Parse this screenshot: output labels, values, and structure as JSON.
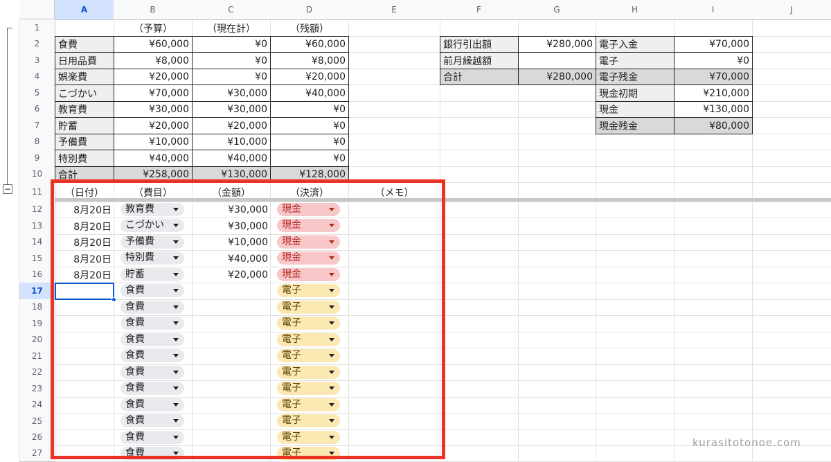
{
  "columns": [
    "A",
    "B",
    "C",
    "D",
    "E",
    "F",
    "G",
    "H",
    "I",
    "J"
  ],
  "rows": [
    "1",
    "2",
    "3",
    "4",
    "5",
    "6",
    "7",
    "8",
    "9",
    "10",
    "11",
    "12",
    "13",
    "14",
    "15",
    "16",
    "17",
    "18",
    "19",
    "20",
    "21",
    "22",
    "23",
    "24",
    "25",
    "26",
    "27"
  ],
  "group_toggle": "−",
  "header_row": {
    "b": "（予算）",
    "c": "（現在計）",
    "d": "（残額）"
  },
  "budget": [
    {
      "cat": "食費",
      "budget": "¥60,000",
      "current": "¥0",
      "remain": "¥60,000"
    },
    {
      "cat": "日用品費",
      "budget": "¥8,000",
      "current": "¥0",
      "remain": "¥8,000"
    },
    {
      "cat": "娯楽費",
      "budget": "¥20,000",
      "current": "¥0",
      "remain": "¥20,000"
    },
    {
      "cat": "こづかい",
      "budget": "¥70,000",
      "current": "¥30,000",
      "remain": "¥40,000"
    },
    {
      "cat": "教育費",
      "budget": "¥30,000",
      "current": "¥30,000",
      "remain": "¥0"
    },
    {
      "cat": "貯蓄",
      "budget": "¥20,000",
      "current": "¥20,000",
      "remain": "¥0"
    },
    {
      "cat": "予備費",
      "budget": "¥10,000",
      "current": "¥10,000",
      "remain": "¥0"
    },
    {
      "cat": "特別費",
      "budget": "¥40,000",
      "current": "¥40,000",
      "remain": "¥0"
    },
    {
      "cat": "合計",
      "budget": "¥258,000",
      "current": "¥130,000",
      "remain": "¥128,000"
    }
  ],
  "bank": [
    {
      "label": "銀行引出額",
      "value": "¥280,000"
    },
    {
      "label": "前月繰越額",
      "value": ""
    },
    {
      "label": "合計",
      "value": "¥280,000"
    }
  ],
  "wallet": [
    {
      "label": "電子入金",
      "value": "¥70,000"
    },
    {
      "label": "電子",
      "value": "¥0"
    },
    {
      "label": "電子残金",
      "value": "¥70,000"
    },
    {
      "label": "現金初期",
      "value": "¥210,000"
    },
    {
      "label": "現金",
      "value": "¥130,000"
    },
    {
      "label": "現金残金",
      "value": "¥80,000"
    }
  ],
  "entry_header": {
    "date": "（日付）",
    "cat": "（費目）",
    "amount": "（金額）",
    "pay": "（決済）",
    "memo": "（メモ）"
  },
  "entries": [
    {
      "date": "8月20日",
      "cat": "教育費",
      "amount": "¥30,000",
      "pay": "現金"
    },
    {
      "date": "8月20日",
      "cat": "こづかい",
      "amount": "¥30,000",
      "pay": "現金"
    },
    {
      "date": "8月20日",
      "cat": "予備費",
      "amount": "¥10,000",
      "pay": "現金"
    },
    {
      "date": "8月20日",
      "cat": "特別費",
      "amount": "¥40,000",
      "pay": "現金"
    },
    {
      "date": "8月20日",
      "cat": "貯蓄",
      "amount": "¥20,000",
      "pay": "現金"
    },
    {
      "date": "",
      "cat": "食費",
      "amount": "",
      "pay": "電子"
    },
    {
      "date": "",
      "cat": "食費",
      "amount": "",
      "pay": "電子"
    },
    {
      "date": "",
      "cat": "食費",
      "amount": "",
      "pay": "電子"
    },
    {
      "date": "",
      "cat": "食費",
      "amount": "",
      "pay": "電子"
    },
    {
      "date": "",
      "cat": "食費",
      "amount": "",
      "pay": "電子"
    },
    {
      "date": "",
      "cat": "食費",
      "amount": "",
      "pay": "電子"
    },
    {
      "date": "",
      "cat": "食費",
      "amount": "",
      "pay": "電子"
    },
    {
      "date": "",
      "cat": "食費",
      "amount": "",
      "pay": "電子"
    },
    {
      "date": "",
      "cat": "食費",
      "amount": "",
      "pay": "電子"
    },
    {
      "date": "",
      "cat": "食費",
      "amount": "",
      "pay": "電子"
    },
    {
      "date": "",
      "cat": "食費",
      "amount": "",
      "pay": "電子"
    }
  ],
  "watermark": "kurasitotonoe.com",
  "colors": {
    "highlight_box": "#ea3323",
    "selection": "#0b57d0",
    "cash_chip": "#f8c7c9",
    "elec_chip": "#fce8b2"
  }
}
